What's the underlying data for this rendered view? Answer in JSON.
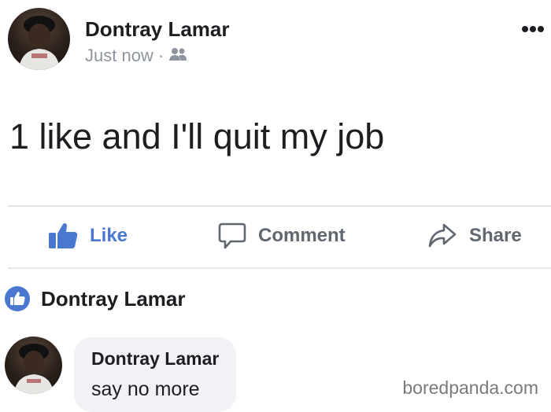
{
  "post": {
    "author": "Dontray Lamar",
    "timestamp": "Just now",
    "separator": "·",
    "audience_icon": "friends-icon",
    "text": "1 like and I'll quit my job"
  },
  "actions": {
    "like_label": "Like",
    "comment_label": "Comment",
    "share_label": "Share"
  },
  "likes": {
    "liker_name": "Dontray Lamar"
  },
  "comment": {
    "author": "Dontray Lamar",
    "text": "say no more"
  },
  "watermark": "boredpanda.com",
  "colors": {
    "like_blue": "#4a78d1",
    "meta_gray": "#8d949e",
    "bubble_bg": "#f0f2f5"
  }
}
